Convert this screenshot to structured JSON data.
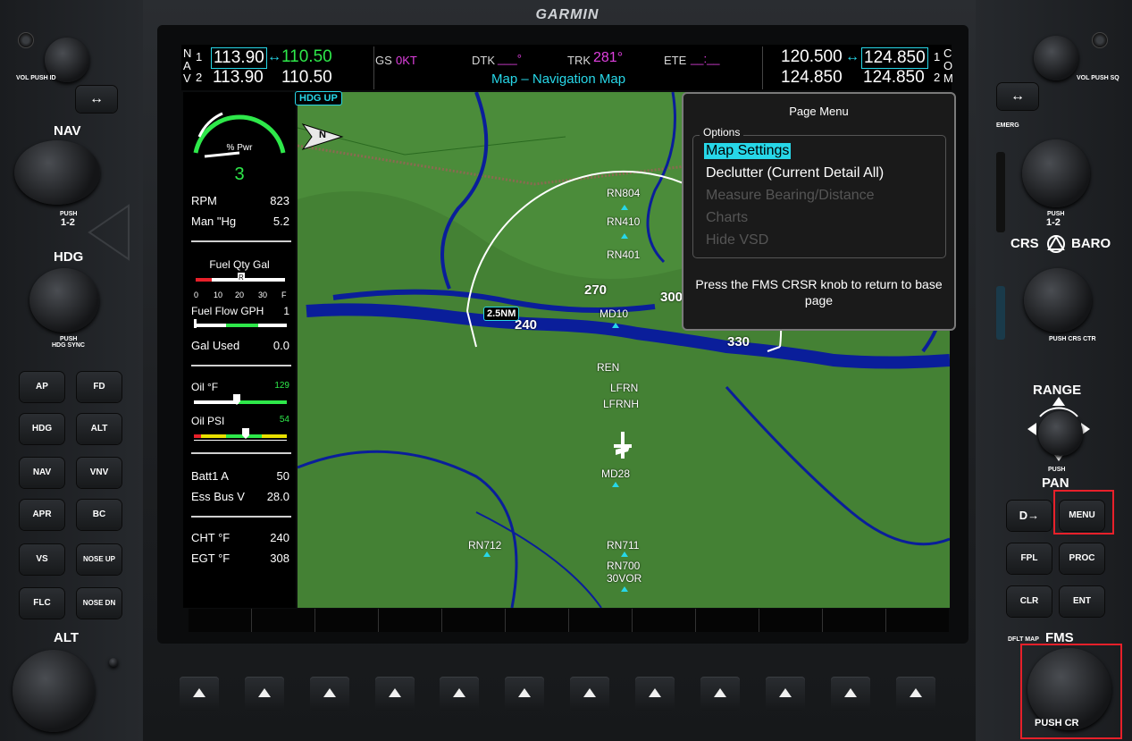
{
  "brand": "GARMIN",
  "nav": {
    "label_n": "N",
    "label_a": "A",
    "label_v": "V",
    "idx1": "1",
    "idx2": "2",
    "nav1_active": "113.90",
    "nav1_standby": "110.50",
    "nav2_active": "113.90",
    "nav2_standby": "110.50",
    "swap_arrow": "↔"
  },
  "status": {
    "gs_label": "GS",
    "gs_value": "0KT",
    "dtk_label": "DTK",
    "dtk_value": "___°",
    "trk_label": "TRK",
    "trk_value": "281°",
    "ete_label": "ETE",
    "ete_value": "__:__",
    "page_title": "Map – Navigation Map"
  },
  "com": {
    "com1_active": "120.500",
    "com1_standby": "124.850",
    "com2_active": "124.850",
    "com2_standby": "124.850",
    "idx1": "1",
    "idx2": "2",
    "label_c": "C",
    "label_o": "O",
    "label_m": "M",
    "swap_arrow": "↔"
  },
  "eis": {
    "pwr_label": "% Pwr",
    "pwr_value": "3",
    "pwr_fraction": 0.03,
    "rpm_label": "RPM",
    "rpm_value": "823",
    "man_label": "Man \"Hg",
    "man_value": "5.2",
    "fuel_qty_label": "Fuel Qty Gal",
    "fuel_scale": [
      "0",
      "10",
      "20",
      "30",
      "F"
    ],
    "fuel_marker": "R",
    "fuel_flow_label": "Fuel Flow GPH",
    "fuel_flow_value": "1",
    "gal_used_label": "Gal Used",
    "gal_used_value": "0.0",
    "oil_f_label": "Oil °F",
    "oil_f_value": "129",
    "oil_psi_label": "Oil PSI",
    "oil_psi_value": "54",
    "batt_label": "Batt1 A",
    "batt_value": "50",
    "essbus_label": "Ess Bus V",
    "essbus_value": "28.0",
    "cht_label": "CHT °F",
    "cht_value": "240",
    "egt_label": "EGT °F",
    "egt_value": "308"
  },
  "map": {
    "orientation": "HDG UP",
    "north_label": "N",
    "range_label": "2.5NM",
    "arc_labels": [
      "240",
      "270",
      "300",
      "330"
    ],
    "waypoints": [
      "RN804",
      "RN410",
      "RN401",
      "MD10",
      "REN",
      "LFRN",
      "LFRNH",
      "MD28",
      "RN712",
      "RN711",
      "RN700",
      "30VOR"
    ]
  },
  "page_menu": {
    "title": "Page Menu",
    "options_label": "Options",
    "items": [
      {
        "label": "Map Settings",
        "state": "selected"
      },
      {
        "label": "Declutter (Current Detail All)",
        "state": "enabled"
      },
      {
        "label": "Measure Bearing/Distance",
        "state": "disabled"
      },
      {
        "label": "Charts",
        "state": "disabled"
      },
      {
        "label": "Hide VSD",
        "state": "disabled"
      }
    ],
    "hint": "Press the FMS CRSR knob to return to base page"
  },
  "bezel_left": {
    "vol_label": "VOL",
    "vol_push": "PUSH ID",
    "swap_icon": "↔",
    "nav_label": "NAV",
    "nav_push": "PUSH",
    "nav_push2": "1-2",
    "hdg_label": "HDG",
    "hdg_push": "PUSH",
    "hdg_sync": "HDG SYNC",
    "buttons": [
      "AP",
      "FD",
      "HDG",
      "ALT",
      "NAV",
      "VNV",
      "APR",
      "BC",
      "VS",
      "NOSE UP",
      "FLC",
      "NOSE DN"
    ],
    "alt_label": "ALT"
  },
  "bezel_right": {
    "vol_label": "VOL",
    "vol_push": "PUSH SQ",
    "swap_icon": "↔",
    "emerg": "EMERG",
    "push": "PUSH",
    "push12": "1-2",
    "crs_label": "CRS",
    "baro_label": "BARO",
    "crs_ctr": "PUSH CRS CTR",
    "range_label": "RANGE",
    "pan_label": "PAN",
    "pan_push": "PUSH",
    "buttons": [
      "D→",
      "MENU",
      "FPL",
      "PROC",
      "CLR",
      "ENT"
    ],
    "dfltmap": "DFLT MAP",
    "fms_label": "FMS",
    "fms_push": "PUSH CR"
  },
  "colors": {
    "cyan": "#27d7e8",
    "magenta": "#e040e0",
    "green": "#2ee84a",
    "highlight_red": "#e8202a"
  }
}
